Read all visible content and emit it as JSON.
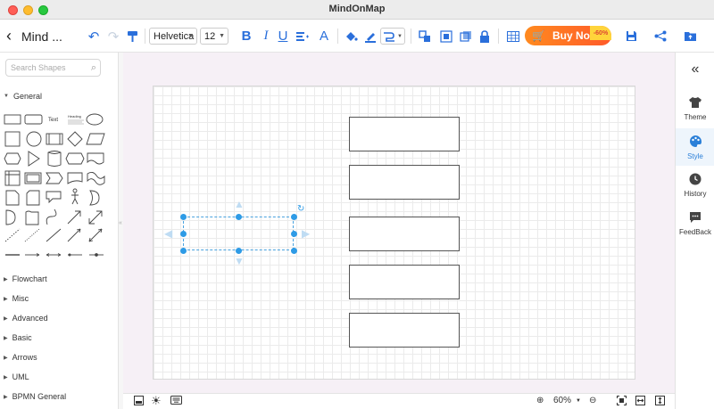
{
  "window": {
    "title": "MindOnMap"
  },
  "toolbar": {
    "doc_title": "Mind ...",
    "font_family": "Helvetica",
    "font_size": "12",
    "bold": "B",
    "italic": "I",
    "underline": "U",
    "font_color": "A",
    "buy_label": "Buy Now",
    "discount": "-60%"
  },
  "left_panel": {
    "search_placeholder": "Search Shapes",
    "general_label": "General",
    "text_shape_label": "Text",
    "heading_shape_label": "Heading",
    "sections": [
      "Flowchart",
      "Misc",
      "Advanced",
      "Basic",
      "Arrows",
      "UML",
      "BPMN General"
    ]
  },
  "right_panel": {
    "tabs": [
      {
        "label": "Theme",
        "icon": "shirt-icon"
      },
      {
        "label": "Style",
        "icon": "palette-icon",
        "active": true
      },
      {
        "label": "History",
        "icon": "clock-icon"
      },
      {
        "label": "FeedBack",
        "icon": "chat-icon"
      }
    ]
  },
  "bottom_bar": {
    "zoom": "60%"
  },
  "colors": {
    "accent": "#2a6fdb",
    "buy": "#ff6a24",
    "selection": "#2e9be6",
    "canvas_bg": "#f6f0f6"
  }
}
